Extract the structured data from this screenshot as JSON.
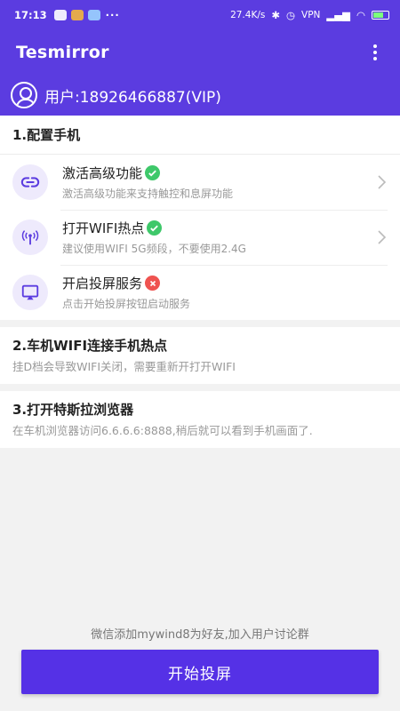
{
  "status_bar": {
    "time": "17:13",
    "more": "···",
    "network_speed": "27.4K/s",
    "vpn": "VPN"
  },
  "app": {
    "title": "Tesmirror"
  },
  "user": {
    "label": "用户:18926466887(VIP)"
  },
  "section1": {
    "header": "1.配置手机",
    "items": [
      {
        "title": "激活高级功能",
        "subtitle": "激活高级功能来支持触控和息屏功能",
        "status": "ok",
        "icon": "link-icon"
      },
      {
        "title": "打开WIFI热点",
        "subtitle": "建议使用WIFI 5G频段，不要使用2.4G",
        "status": "ok",
        "icon": "hotspot-icon"
      },
      {
        "title": "开启投屏服务",
        "subtitle": "点击开始投屏按钮启动服务",
        "status": "error",
        "icon": "cast-icon"
      }
    ]
  },
  "section2": {
    "header": "2.车机WIFI连接手机热点",
    "desc": "挂D档会导致WIFI关闭，需要重新开打开WIFI"
  },
  "section3": {
    "header": "3.打开特斯拉浏览器",
    "desc": "在车机浏览器访问6.6.6.6:8888,稍后就可以看到手机画面了."
  },
  "footer": {
    "hint": "微信添加mywind8为好友,加入用户讨论群",
    "button": "开始投屏"
  },
  "colors": {
    "primary": "#5b3ce0",
    "button": "#5531e6",
    "ok": "#3ec86a",
    "error": "#ef5350"
  }
}
